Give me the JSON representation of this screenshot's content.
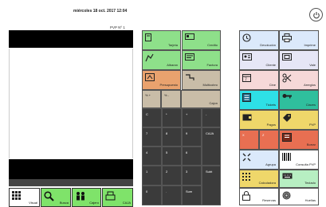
{
  "header": {
    "datetime": "miércoles 18 oct. 2017 12:04",
    "pvp_label": "PVP Nº 1"
  },
  "ticket": {
    "iva_label": "IVA"
  },
  "bottom_bar": [
    {
      "name": "visual-button",
      "label": "Visual",
      "icon": "grid-icon",
      "bg": "#ffffff"
    },
    {
      "name": "busca-button",
      "label": "Busca",
      "icon": "search-icon",
      "bg": "#7fe36a"
    },
    {
      "name": "cajero-button",
      "label": "Cajero",
      "icon": "cashier-icon",
      "bg": "#7fe36a"
    },
    {
      "name": "caja-button",
      "label": "CAJA",
      "icon": "register-icon",
      "bg": "#7fe36a"
    }
  ],
  "actions_mid": {
    "tarjeta": "Tarjeta",
    "credito": "Credito",
    "albaran": "Albaran",
    "factura": "Factura",
    "presupuesto": "Presupuesto",
    "multicobro": "Multicobro",
    "pct_plus": "% +",
    "pct_minus": "% -",
    "cajon": "Cajon"
  },
  "keypad": {
    "c": "C",
    "mul": "*",
    "plus": "+",
    "minus": "-",
    "seven": "7",
    "eight": "8",
    "nine": "9",
    "caja": "CAJA",
    "four": "4",
    "five": "5",
    "six": "6",
    "one": "1",
    "two": "2",
    "three": "3",
    "subt": "Subt",
    "zero": "0",
    "dot": ".",
    "sum": "Sum"
  },
  "actions_right": {
    "devolucion": "Devolución",
    "imprime": "Imprime",
    "cliente": "Cliente",
    "vale": "Vale",
    "cine": "Cine",
    "arreglos": "Arreglos",
    "tickets": "Tickets",
    "claves": "Claves",
    "pagos": "Pagos",
    "pvp": "PVP",
    "x": "X",
    "z": "Z",
    "borrar": "Borrar",
    "agrupa": "Agrupa",
    "consulta_pvp": "Consulta PVP",
    "calculadora": "Calculadora",
    "teclado": "Teclado",
    "reservas": "Reservas",
    "huellas": "Huellas"
  }
}
